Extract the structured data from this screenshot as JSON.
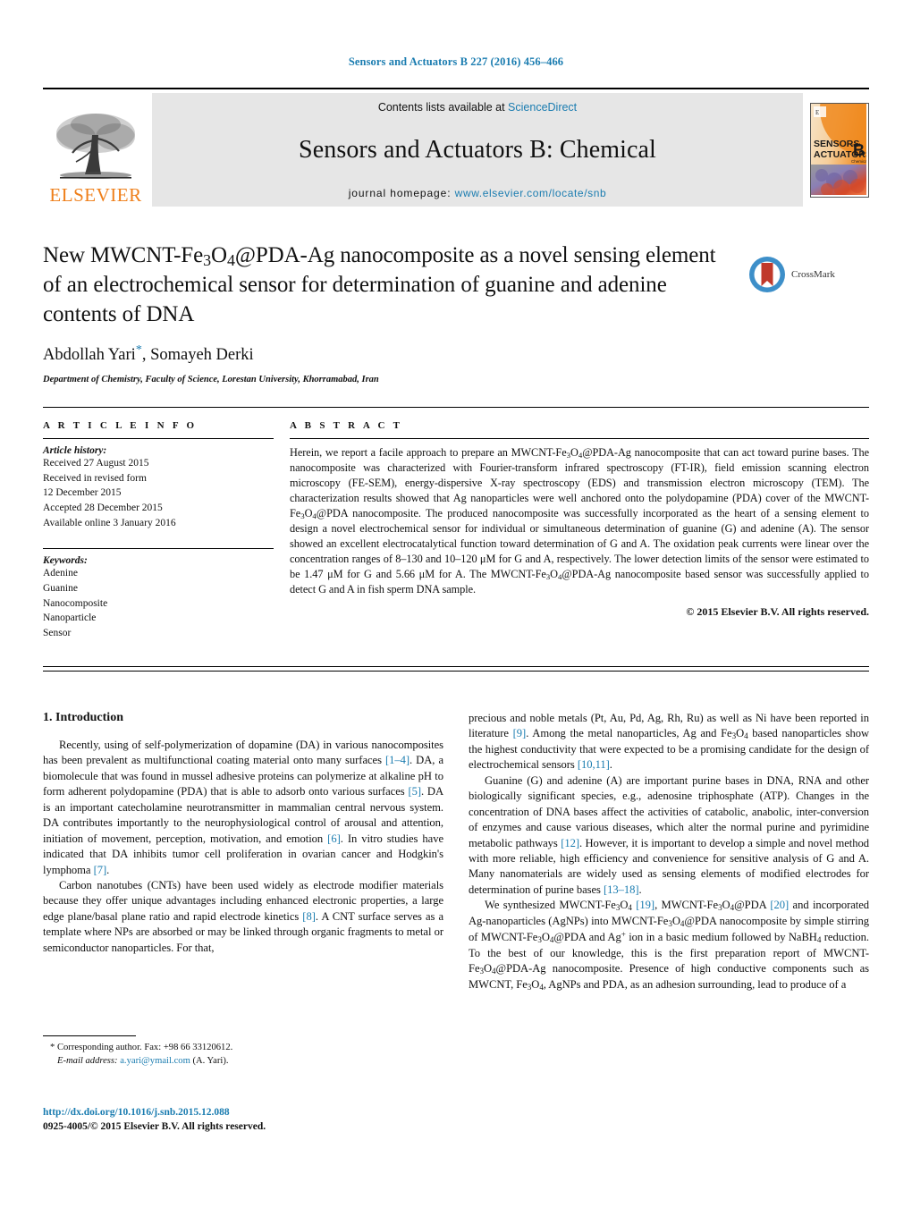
{
  "running_head": "Sensors and Actuators B 227 (2016) 456–466",
  "masthead": {
    "publisher_logo_text": "ELSEVIER",
    "contents_prefix": "Contents lists available at ",
    "contents_link": "ScienceDirect",
    "journal_title": "Sensors and Actuators B: Chemical",
    "homepage_prefix": "journal homepage: ",
    "homepage_url": "www.elsevier.com/locate/snb",
    "cover_line1": "SENSORS",
    "cover_and": "and",
    "cover_line2": "ACTUATORS",
    "cover_letter": "B",
    "cover_sub": "Chemical",
    "cover_colors": {
      "orange": "#f08a1e",
      "cream": "#f5d9b4",
      "purple": "#8a7fb5",
      "red": "#d44a2a",
      "gray": "#9a9a9a"
    }
  },
  "crossmark": {
    "label": "CrossMark",
    "ring_color": "#3d8fc9",
    "mark_color": "#c0392b"
  },
  "article": {
    "title_line1": "New MWCNT-Fe",
    "title_sub1": "3",
    "title_line1b": "O",
    "title_sub2": "4",
    "title_line1c": "@PDA-Ag nanocomposite as a novel sensing",
    "title_line2": "element of an electrochemical sensor for determination of guanine",
    "title_line3": "and adenine contents of DNA",
    "authors_a": "Abdollah Yari",
    "authors_star": "*",
    "authors_b": ", Somayeh Derki",
    "affiliation": "Department of Chemistry, Faculty of Science, Lorestan University, Khorramabad, Iran"
  },
  "info": {
    "heading": "A R T I C L E   I N F O",
    "history_label": "Article history:",
    "history": [
      "Received 27 August 2015",
      "Received in revised form",
      "12 December 2015",
      "Accepted 28 December 2015",
      "Available online 3 January 2016"
    ],
    "keywords_label": "Keywords:",
    "keywords": [
      "Adenine",
      "Guanine",
      "Nanocomposite",
      "Nanoparticle",
      "Sensor"
    ]
  },
  "abstract": {
    "heading": "A B S T R A C T",
    "p1_a": "Herein, we report a facile approach to prepare an MWCNT-Fe",
    "p1_sub1": "3",
    "p1_b": "O",
    "p1_sub2": "4",
    "p1_c": "@PDA-Ag nanocomposite that can act toward purine bases. The nanocomposite was characterized with Fourier-transform infrared spectroscopy (FT-IR), field emission scanning electron microscopy (FE-SEM), energy-dispersive X-ray spectroscopy (EDS) and transmission electron microscopy (TEM). The characterization results showed that Ag nanoparticles were well anchored onto the polydopamine (PDA) cover of the MWCNT-Fe",
    "p1_d": "O",
    "p1_e": "@PDA nanocomposite. The produced nanocomposite was successfully incorporated as the heart of a sensing element to design a novel electrochemical sensor for individual or simultaneous determination of guanine (G) and adenine (A). The sensor showed an excellent electrocatalytical function toward determination of G and A. The oxidation peak currents were linear over the concentration ranges of 8–130 and 10–120 μM for G and A, respectively. The lower detection limits of the sensor were estimated to be 1.47 μM for G and 5.66 μM for A. The MWCNT-Fe",
    "p1_f": "O",
    "p1_g": "@PDA-Ag nanocomposite based sensor was successfully applied to detect G and A in fish sperm DNA sample.",
    "copyright": "© 2015 Elsevier B.V. All rights reserved."
  },
  "body": {
    "section_number": "1.",
    "section_title": "Introduction",
    "left": {
      "p1_a": "Recently, using of self-polymerization of dopamine (DA) in various nanocomposites has been prevalent as multifunctional coating material onto many surfaces ",
      "p1_ref1": "[1–4]",
      "p1_b": ". DA, a biomolecule that was found in mussel adhesive proteins can polymerize at alkaline pH to form adherent polydopamine (PDA) that is able to adsorb onto various surfaces ",
      "p1_ref2": "[5]",
      "p1_c": ". DA is an important catecholamine neurotransmitter in mammalian central nervous system. DA contributes importantly to the neurophysiological control of arousal and attention, initiation of movement, perception, motivation, and emotion ",
      "p1_ref3": "[6]",
      "p1_d": ". In vitro studies have indicated that DA inhibits tumor cell proliferation in ovarian cancer and Hodgkin's lymphoma ",
      "p1_ref4": "[7]",
      "p1_e": ".",
      "p2_a": "Carbon nanotubes (CNTs) have been used widely as electrode modifier materials because they offer unique advantages including enhanced electronic properties, a large edge plane/basal plane ratio and rapid electrode kinetics ",
      "p2_ref1": "[8]",
      "p2_b": ". A CNT surface serves as a template where NPs are absorbed or may be linked through organic fragments to metal or semiconductor nanoparticles. For that,"
    },
    "right": {
      "p1_a": "precious and noble metals (Pt, Au, Pd, Ag, Rh, Ru) as well as Ni have been reported in literature ",
      "p1_ref1": "[9]",
      "p1_b": ". Among the metal nanoparticles, Ag and Fe",
      "p1_sub": "3",
      "p1_c": "O",
      "p1_sub2": "4",
      "p1_d": " based nanoparticles show the highest conductivity that were expected to be a promising candidate for the design of electrochemical sensors ",
      "p1_ref2": "[10,11]",
      "p1_e": ".",
      "p2_a": "Guanine (G) and adenine (A) are important purine bases in DNA, RNA and other biologically significant species, e.g., adenosine triphosphate (ATP). Changes in the concentration of DNA bases affect the activities of catabolic, anabolic, inter-conversion of enzymes and cause various diseases, which alter the normal purine and pyrimidine metabolic pathways ",
      "p2_ref1": "[12]",
      "p2_b": ". However, it is important to develop a simple and novel method with more reliable, high efficiency and convenience for sensitive analysis of G and A. Many nanomaterials are widely used as sensing elements of modified electrodes for determination of purine bases ",
      "p2_ref2": "[13–18]",
      "p2_c": ".",
      "p3_a": "We synthesized MWCNT-Fe",
      "p3_sub1": "3",
      "p3_b": "O",
      "p3_sub2": "4",
      "p3_ref1": "[19]",
      "p3_c": ", MWCNT-Fe",
      "p3_d": "O",
      "p3_e": "@PDA ",
      "p3_ref2": "[20]",
      "p3_f": " and incorporated Ag-nanoparticles (AgNPs) into MWCNT-Fe",
      "p3_g": "O",
      "p3_h": "@PDA nanocomposite by simple stirring of MWCNT-Fe",
      "p3_i": "O",
      "p3_j": "@PDA and Ag",
      "p3_sup": "+",
      "p3_k": " ion in a basic medium followed by NaBH",
      "p3_sub3": "4",
      "p3_l": " reduction. To the best of our knowledge, this is the first preparation report of MWCNT-Fe",
      "p3_m": "O",
      "p3_n": "@PDA-Ag nanocomposite. Presence of high conductive components such as MWCNT, Fe",
      "p3_o": "O",
      "p3_p": ", AgNPs and PDA, as an adhesion surrounding, lead to produce of a"
    }
  },
  "footnote": {
    "star": "*",
    "corresponding": " Corresponding author. Fax: +98 66 33120612.",
    "email_label": "E-mail address:",
    "email": "a.yari@ymail.com",
    "email_suffix": " (A. Yari)."
  },
  "footer": {
    "doi": "http://dx.doi.org/10.1016/j.snb.2015.12.088",
    "issn": "0925-4005/© 2015 Elsevier B.V. All rights reserved."
  },
  "colors": {
    "link": "#1a7cb0",
    "elsevier_orange": "#ef7f1a"
  }
}
